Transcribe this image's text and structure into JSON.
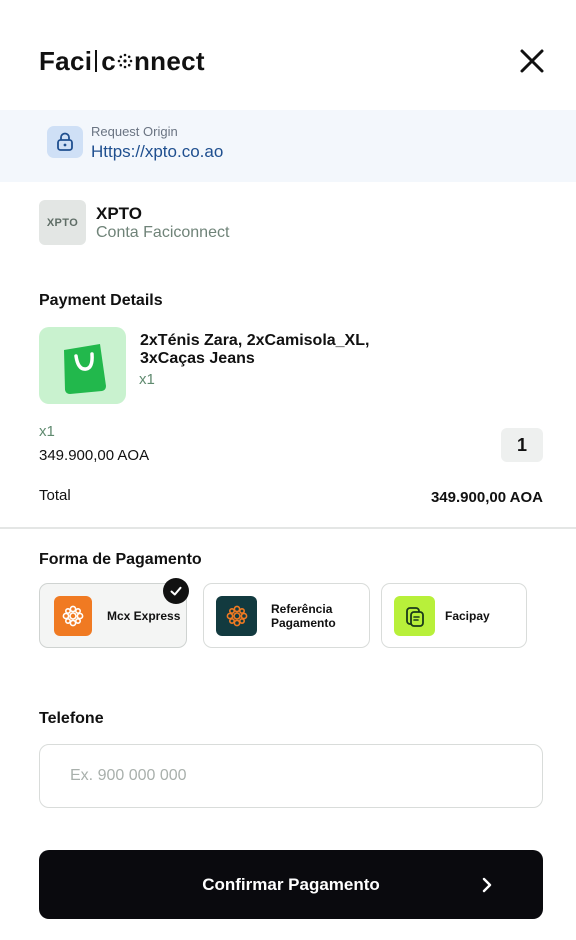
{
  "brand": {
    "logo_left": "Faci",
    "logo_right": "nnect"
  },
  "origin": {
    "label": "Request Origin",
    "url": "Https://xpto.co.ao"
  },
  "merchant": {
    "logo_text": "XPTO",
    "name": "XPTO",
    "subtitle": "Conta Faciconnect"
  },
  "payment_details": {
    "title": "Payment Details",
    "product_name": "2xTénis Zara, 2xCamisola_XL, 3xCaças Jeans",
    "product_qty": "x1",
    "qty_small": "x1",
    "price": "349.900,00 AOA",
    "quantity": "1",
    "total_label": "Total",
    "total_value": "349.900,00 AOA"
  },
  "payment_method": {
    "title": "Forma de Pagamento",
    "options": [
      {
        "label": "Mcx Express",
        "selected": true
      },
      {
        "label": "Referência Pagamento",
        "selected": false
      },
      {
        "label": "Facipay",
        "selected": false
      }
    ]
  },
  "phone": {
    "label": "Telefone",
    "placeholder": "Ex. 900 000 000",
    "value": ""
  },
  "confirm": {
    "label": "Confirmar Pagamento"
  },
  "colors": {
    "accent_dark": "#0a0a0e",
    "origin_bg": "#f3f7fc",
    "link_blue": "#1f4f8f",
    "product_bg": "#c9f2cf",
    "product_green": "#22b84c",
    "mcx_orange": "#f07a22",
    "referencia_teal": "#123a3f",
    "facipay_lime": "#b8f03a"
  }
}
